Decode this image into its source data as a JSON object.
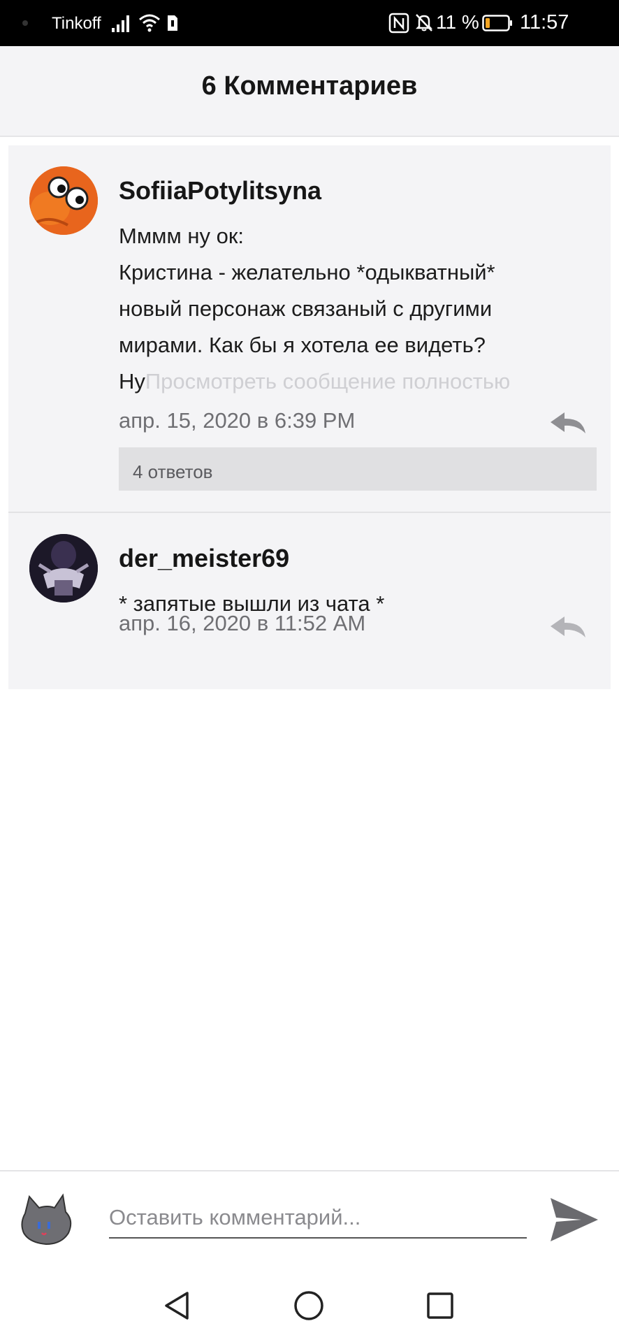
{
  "status_bar": {
    "carrier": "Tinkoff",
    "battery_percent": "11 %",
    "time": "11:57",
    "icons": [
      "signal-icon",
      "wifi-icon",
      "sim-icon",
      "nfc-icon",
      "bell-off-icon",
      "battery-icon"
    ],
    "battery_color": "#f5a623"
  },
  "header": {
    "title": "6 Комментариев"
  },
  "comments": [
    {
      "username": "SofiiaPotylitsyna",
      "body_lines": [
        "Мммм ну ок:",
        "Кристина - желательно *одыкватный*",
        "новый персонаж связаный с другими",
        "мирами. Как бы я хотела ее видеть?",
        "Ну"
      ],
      "see_full": "Просмотреть сообщение полностью",
      "timestamp": "апр. 15, 2020 в 6:39 PM",
      "replies": "4 ответов",
      "avatar": "orange-cartoon-avatar"
    },
    {
      "username": "der_meister69",
      "body_lines": [
        "* запятые вышли из чата *"
      ],
      "timestamp": "апр. 16, 2020 в 11:52 AM",
      "avatar": "dark-figure-avatar"
    }
  ],
  "input": {
    "placeholder": "Оставить комментарий..."
  },
  "colors": {
    "card_bg": "#f4f4f6",
    "replies_bg": "#e0e0e2",
    "accent_icon": "#8e8e92"
  }
}
